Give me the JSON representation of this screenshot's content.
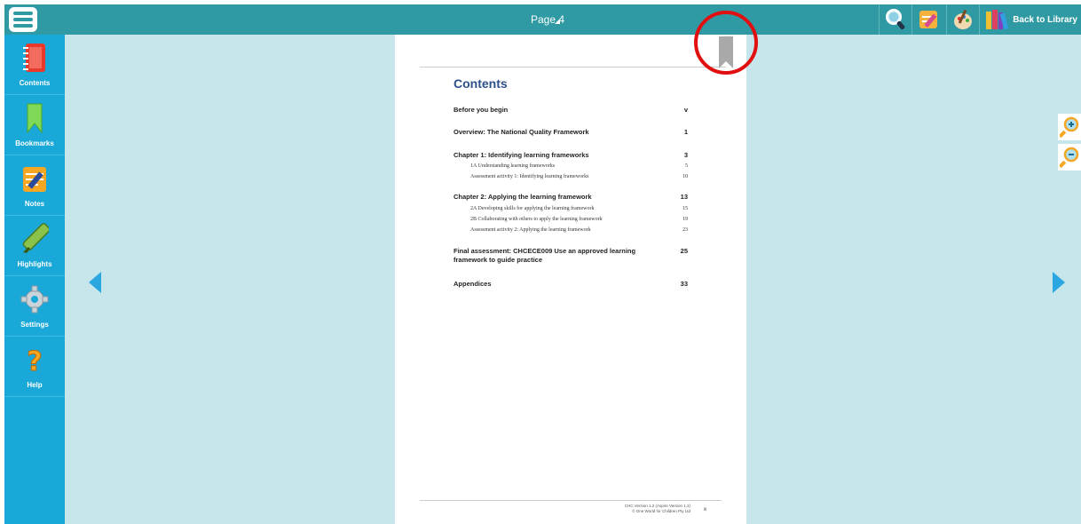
{
  "topbar": {
    "page_label": "Page 4",
    "back_to_library": "Back to Library",
    "icons": [
      "menu-icon",
      "search-icon",
      "edit-notes-icon",
      "palette-icon",
      "library-books-icon"
    ]
  },
  "sidebar": {
    "items": [
      {
        "label": "Contents",
        "icon": "notebook-icon"
      },
      {
        "label": "Bookmarks",
        "icon": "bookmark-icon"
      },
      {
        "label": "Notes",
        "icon": "notes-pencil-icon"
      },
      {
        "label": "Highlights",
        "icon": "highlighter-icon"
      },
      {
        "label": "Settings",
        "icon": "gear-icon"
      },
      {
        "label": "Help",
        "icon": "question-icon"
      }
    ]
  },
  "document": {
    "title": "Contents",
    "entries": [
      {
        "text": "Before you begin",
        "page": "v"
      },
      {
        "text": "Overview: The National Quality Framework",
        "page": "1"
      },
      {
        "text": "Chapter 1: Identifying learning frameworks",
        "page": "3"
      },
      {
        "text": "1A   Understanding learning frameworks",
        "page": "5"
      },
      {
        "text": "Assessment activity 1: Identifying learning frameworks",
        "page": "10"
      },
      {
        "text": "Chapter 2: Applying the learning framework",
        "page": "13"
      },
      {
        "text": "2A   Developing skills for applying the learning framework",
        "page": "15"
      },
      {
        "text": "2B   Collaborating with others to apply the learning framework",
        "page": "19"
      },
      {
        "text": "Assessment activity 2: Applying the learning framework",
        "page": "23"
      },
      {
        "text": "Final assessment: CHCECE009 Use an approved learning framework to guide practice",
        "page": "25"
      },
      {
        "text": "Appendices",
        "page": "33"
      }
    ],
    "footer_line1": "CHC Version 1.2 (Aspire Version 1.2)",
    "footer_line2": "© One World for Children Pty Ltd",
    "footer_page": "iii"
  },
  "colors": {
    "topbar": "#2f9aa3",
    "sidebar": "#1aa8d8",
    "background": "#c7e6ec",
    "accent_arrow": "#2aa7e0",
    "annotation_circle": "#e01010",
    "title_blue": "#2d4f8a"
  }
}
